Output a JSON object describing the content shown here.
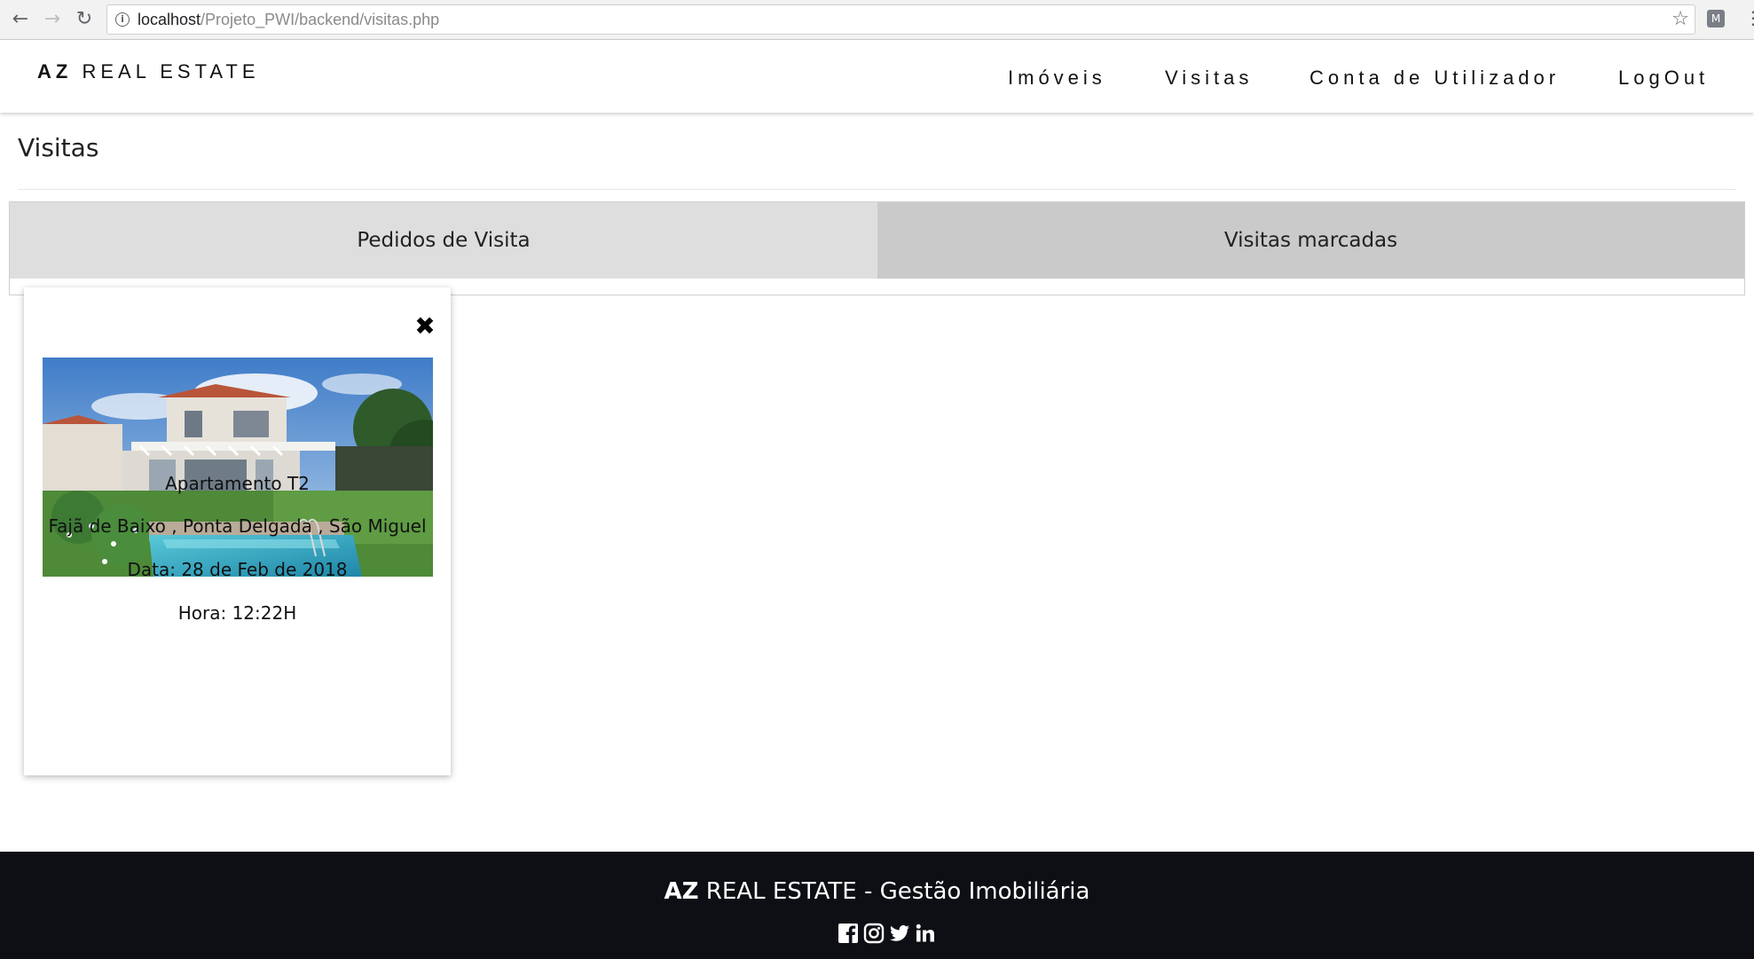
{
  "browser": {
    "url_host": "localhost",
    "url_path": "/Projeto_PWI/backend/visitas.php"
  },
  "navbar": {
    "brand_bold": "AZ",
    "brand_rest": "REAL ESTATE",
    "links": [
      "Imóveis",
      "Visitas",
      "Conta de Utilizador",
      "LogOut"
    ]
  },
  "page": {
    "title": "Visitas"
  },
  "tabs": [
    "Pedidos de Visita",
    "Visitas marcadas"
  ],
  "card": {
    "close_symbol": "✖",
    "property_type": "Apartamento T2",
    "location": "Fajã de Baixo , Ponta Delgada , São Miguel",
    "date": "Data: 28 de Feb de 2018",
    "time": "Hora: 12:22H"
  },
  "footer": {
    "brand_bold": "AZ",
    "brand_rest": "REAL ESTATE - Gestão Imobiliária",
    "social_icons": [
      "facebook-icon",
      "instagram-icon",
      "twitter-icon",
      "linkedin-icon"
    ]
  },
  "colors": {
    "tab_active": "#dedede",
    "tab_inactive": "#cacaca",
    "footer_bg": "#0d0f14"
  }
}
